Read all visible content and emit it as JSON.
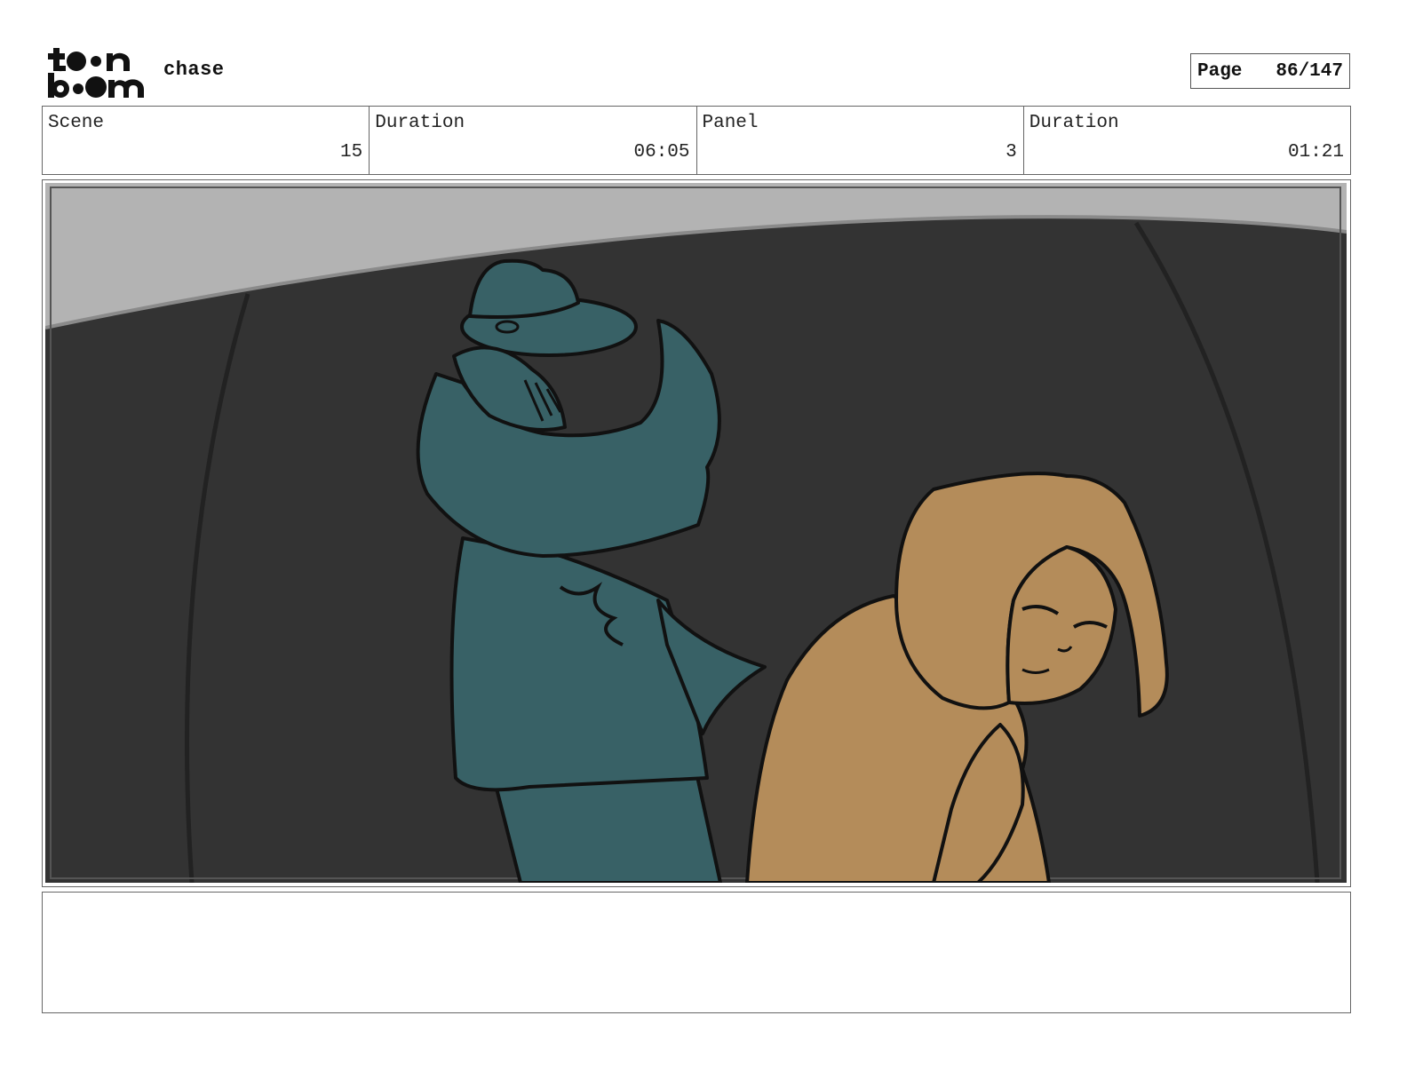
{
  "header": {
    "logo": "toonboom-logo",
    "logo_text": "toonboom",
    "project_title": "chase",
    "page_label": "Page",
    "page_value": "86/147"
  },
  "info": {
    "scene_label": "Scene",
    "scene_value": "15",
    "scene_duration_label": "Duration",
    "scene_duration_value": "06:05",
    "panel_label": "Panel",
    "panel_value": "3",
    "panel_duration_label": "Duration",
    "panel_duration_value": "01:21"
  },
  "panel": {
    "image": "storyboard-panel-drawing",
    "colors": {
      "sky": "#b3b3b3",
      "wall": "#333333",
      "teal_figure": "#386166",
      "tan_figure": "#b48c5a",
      "line": "#111111"
    }
  },
  "notes": {
    "text": ""
  }
}
